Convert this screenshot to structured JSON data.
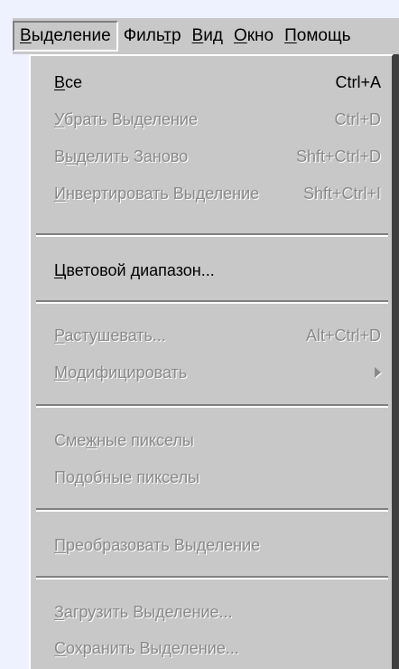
{
  "menubar": {
    "items": [
      {
        "label": "Выделение",
        "mnemonic_first": "В",
        "rest": "ыделение",
        "active": true
      },
      {
        "label": "Фильтр",
        "pre": "Филь",
        "mnemonic": "т",
        "post": "р"
      },
      {
        "label": "Вид",
        "mnemonic_first": "В",
        "rest": "ид"
      },
      {
        "label": "Окно",
        "mnemonic_first": "О",
        "rest": "кно"
      },
      {
        "label": "Помощь",
        "mnemonic_first": "П",
        "rest": "омощь"
      }
    ]
  },
  "dropdown": {
    "items": [
      {
        "pre": "",
        "mnemonic": "В",
        "post": "се",
        "shortcut": "Ctrl+A",
        "enabled": true
      },
      {
        "pre": "",
        "mnemonic": "У",
        "post": "брать Выделение",
        "shortcut": "Ctrl+D",
        "enabled": false
      },
      {
        "pre": "В",
        "mnemonic": "ы",
        "post": "делить Заново",
        "shortcut": "Shft+Ctrl+D",
        "enabled": false
      },
      {
        "pre": "",
        "mnemonic": "И",
        "post": "нвертировать Выделение",
        "shortcut": "Shft+Ctrl+I",
        "enabled": false
      },
      {
        "pre": "",
        "mnemonic": "Ц",
        "post": "ветовой диапазон...",
        "shortcut": "",
        "enabled": true
      },
      {
        "pre": "",
        "mnemonic": "Р",
        "post": "астушевать...",
        "shortcut": "Alt+Ctrl+D",
        "enabled": false
      },
      {
        "pre": "",
        "mnemonic": "М",
        "post": "одифицировать",
        "shortcut": "",
        "enabled": false,
        "submenu": true
      },
      {
        "pre": "Сме",
        "mnemonic": "ж",
        "post": "ные пикселы",
        "shortcut": "",
        "enabled": false
      },
      {
        "pre": "По",
        "mnemonic": "д",
        "post": "обные пикселы",
        "shortcut": "",
        "enabled": false
      },
      {
        "pre": "",
        "mnemonic": "П",
        "post": "реобразовать Выделение",
        "shortcut": "",
        "enabled": false
      },
      {
        "pre": "",
        "mnemonic": "З",
        "post": "агрузить Выделение...",
        "shortcut": "",
        "enabled": false
      },
      {
        "pre": "",
        "mnemonic": "С",
        "post": "охранить Выделение...",
        "shortcut": "",
        "enabled": false
      }
    ]
  },
  "colors": {
    "menu_face": "#c8c8c8",
    "disabled_text": "#8a8a8a",
    "enabled_text": "#000000",
    "page_background": "#eef2ff"
  }
}
